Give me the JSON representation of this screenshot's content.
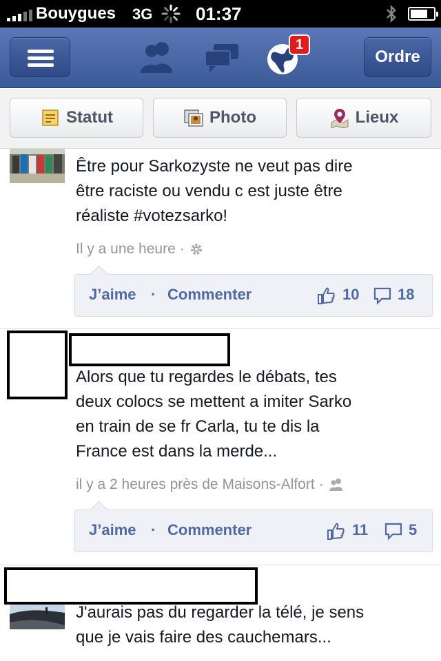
{
  "status_bar": {
    "carrier": "Bouygues",
    "network": "3G",
    "time": "01:37"
  },
  "nav": {
    "notification_count": "1",
    "order_label": "Ordre"
  },
  "composer": {
    "status_label": "Statut",
    "photo_label": "Photo",
    "places_label": "Lieux"
  },
  "posts": [
    {
      "text_lines": [
        "Être pour Sarkozyste ne veut pas dire",
        "être raciste ou vendu c est juste être",
        "réaliste #votezsarko!"
      ],
      "time": "Il y a une heure",
      "like_label": "J’aime",
      "sep": "·",
      "comment_label": "Commenter",
      "likes": "10",
      "comments": "18"
    },
    {
      "text_lines": [
        "Alors que tu regardes le débats, tes",
        "deux colocs se mettent a imiter Sarko",
        "en train de se fr Carla, tu te dis la",
        "France est dans la merde..."
      ],
      "time": "il y a 2 heures près de Maisons-Alfort",
      "like_label": "J’aime",
      "sep": "·",
      "comment_label": "Commenter",
      "likes": "11",
      "comments": "5"
    },
    {
      "text_lines": [
        "J'aurais pas du regarder la télé, je sens",
        "que je vais faire des cauchemars..."
      ]
    }
  ]
}
